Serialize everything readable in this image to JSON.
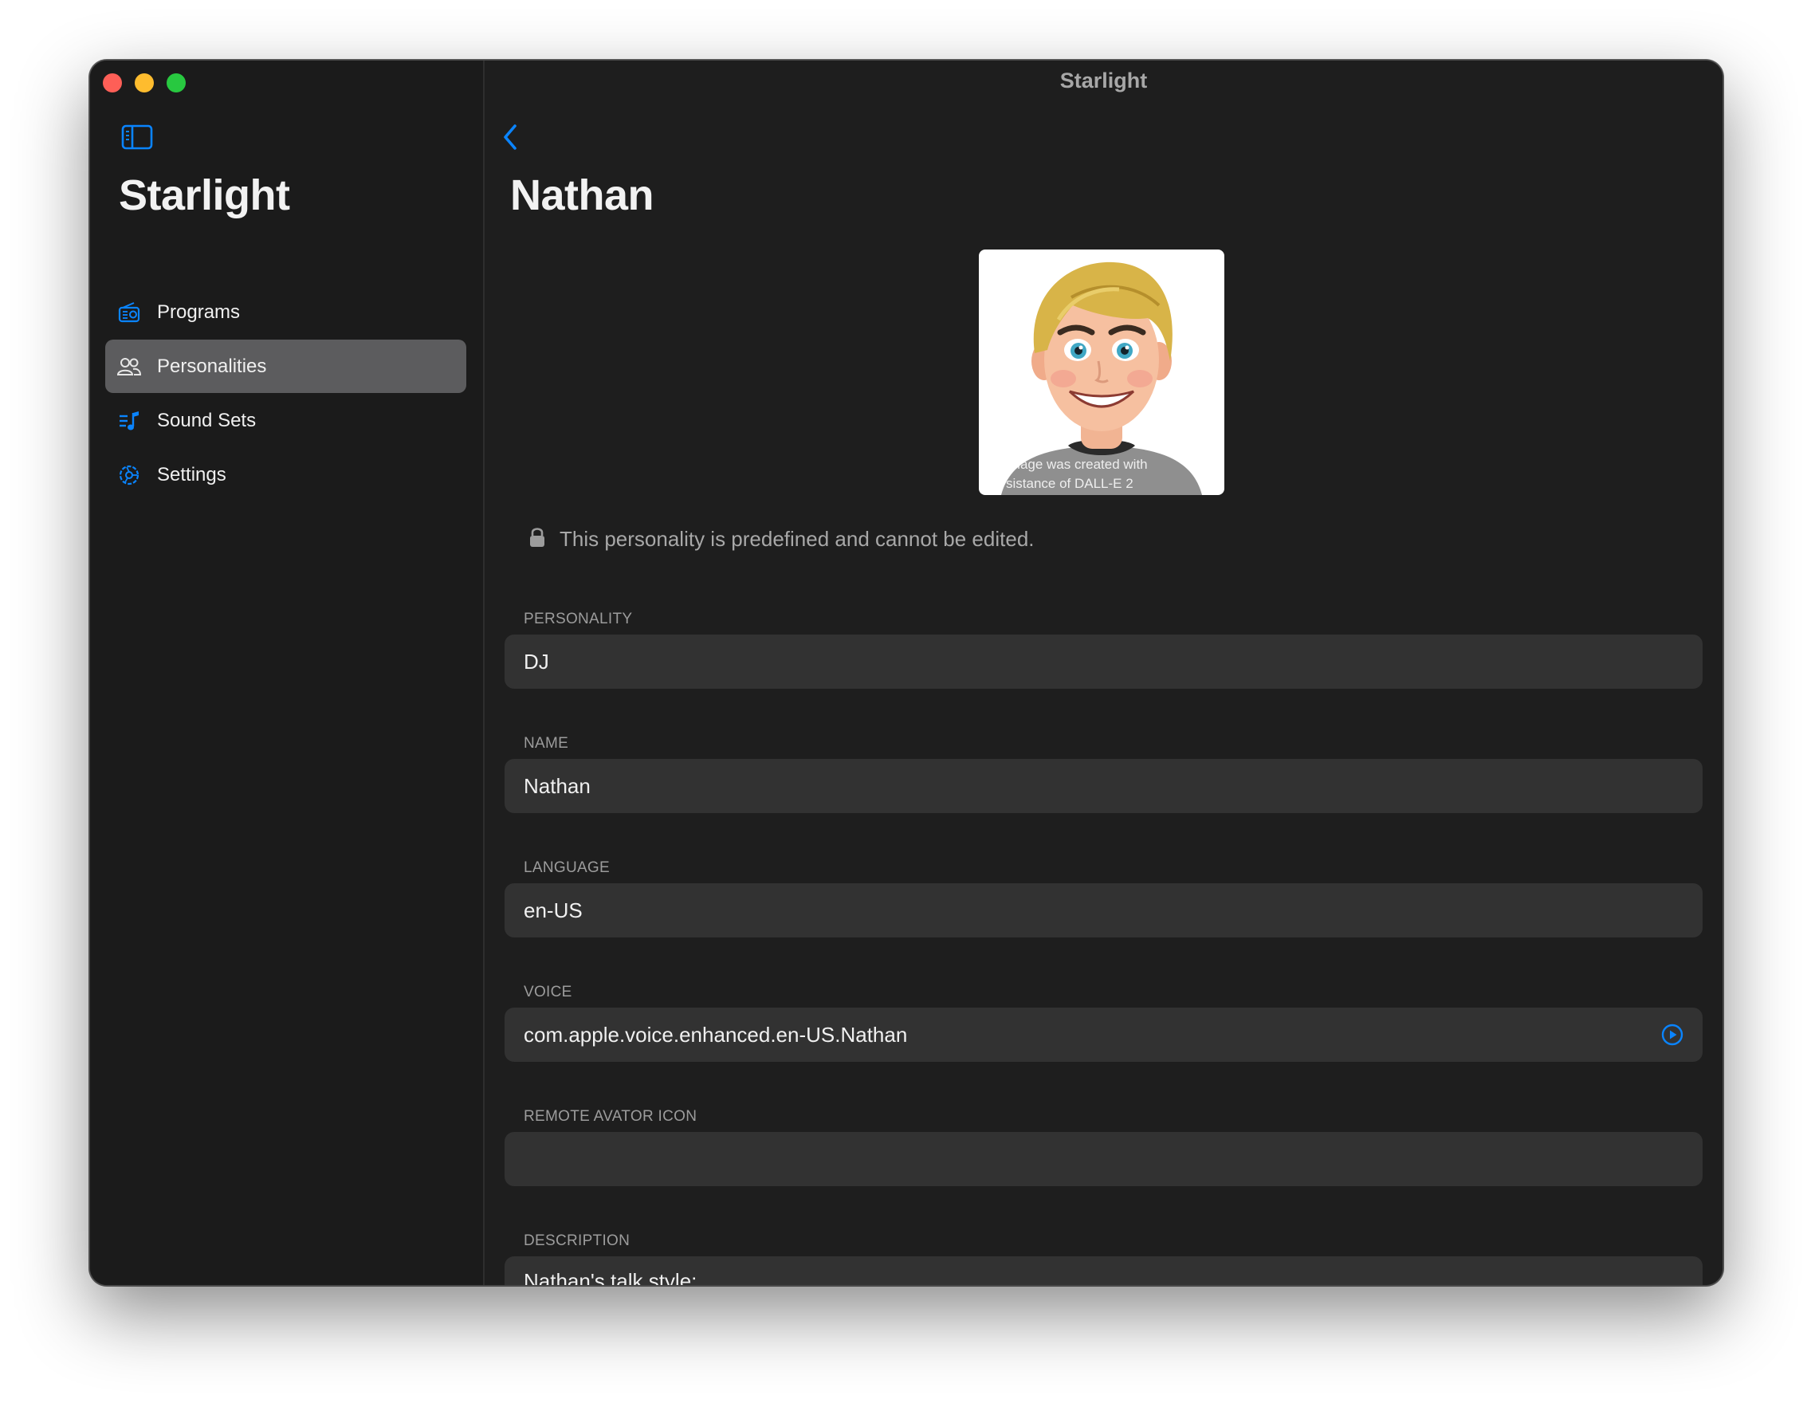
{
  "window": {
    "title": "Starlight"
  },
  "sidebar": {
    "app_title": "Starlight",
    "items": [
      {
        "label": "Programs",
        "icon": "radio-icon",
        "selected": false
      },
      {
        "label": "Personalities",
        "icon": "people-icon",
        "selected": true
      },
      {
        "label": "Sound Sets",
        "icon": "music-list-icon",
        "selected": false
      },
      {
        "label": "Settings",
        "icon": "gear-icon",
        "selected": false
      }
    ]
  },
  "detail": {
    "title": "Nathan",
    "avatar_caption_line1": "image was created with",
    "avatar_caption_line2": "sistance of DALL-E 2",
    "notice": "This personality is predefined and cannot be edited.",
    "fields": [
      {
        "label": "PERSONALITY",
        "value": "DJ"
      },
      {
        "label": "NAME",
        "value": "Nathan"
      },
      {
        "label": "LANGUAGE",
        "value": "en-US"
      },
      {
        "label": "VOICE",
        "value": "com.apple.voice.enhanced.en-US.Nathan"
      },
      {
        "label": "REMOTE AVATOR ICON",
        "value": ""
      },
      {
        "label": "DESCRIPTION",
        "value": "Nathan's talk style:"
      }
    ]
  },
  "colors": {
    "accent": "#0a84ff",
    "selected_row": "#5c5c5e",
    "field_bg": "#323232",
    "window_bg": "#1e1e1e"
  }
}
